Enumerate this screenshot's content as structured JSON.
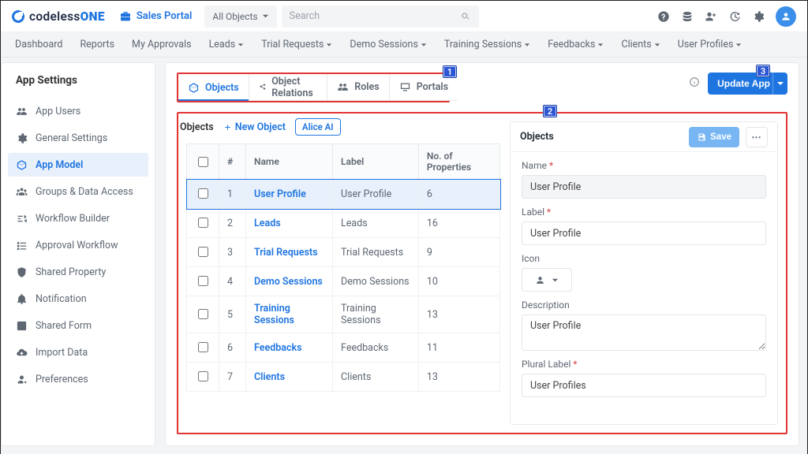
{
  "logo": {
    "text_a": "codeless",
    "text_b": "ONE"
  },
  "portal_name": "Sales Portal",
  "object_selector": "All Objects",
  "search_placeholder": "Search",
  "nav": [
    "Dashboard",
    "Reports",
    "My Approvals",
    "Leads",
    "Trial Requests",
    "Demo Sessions",
    "Training Sessions",
    "Feedbacks",
    "Clients",
    "User Profiles"
  ],
  "nav_caret": [
    false,
    false,
    false,
    true,
    true,
    true,
    true,
    true,
    true,
    true
  ],
  "side_title": "App Settings",
  "side_items": [
    "App Users",
    "General Settings",
    "App Model",
    "Groups & Data Access",
    "Workflow Builder",
    "Approval Workflow",
    "Shared Property",
    "Notification",
    "Shared Form",
    "Import Data",
    "Preferences"
  ],
  "side_active_index": 2,
  "tabs": [
    "Objects",
    "Object Relations",
    "Roles",
    "Portals"
  ],
  "tab_active_index": 0,
  "update_btn": "Update App",
  "crumbs_label": "Objects",
  "new_object": "New Object",
  "alice_ai": "Alice AI",
  "table_headers": [
    "",
    "#",
    "Name",
    "Label",
    "No. of Properties"
  ],
  "table_rows": [
    {
      "n": 1,
      "name": "User Profile",
      "label": "User Profile",
      "props": 6,
      "selected": true
    },
    {
      "n": 2,
      "name": "Leads",
      "label": "Leads",
      "props": 16
    },
    {
      "n": 3,
      "name": "Trial Requests",
      "label": "Trial Requests",
      "props": 9
    },
    {
      "n": 4,
      "name": "Demo Sessions",
      "label": "Demo Sessions",
      "props": 10
    },
    {
      "n": 5,
      "name": "Training Sessions",
      "label": "Training Sessions",
      "props": 13
    },
    {
      "n": 6,
      "name": "Feedbacks",
      "label": "Feedbacks",
      "props": 11
    },
    {
      "n": 7,
      "name": "Clients",
      "label": "Clients",
      "props": 13
    }
  ],
  "form": {
    "title": "Objects",
    "save": "Save",
    "fields": {
      "name_label": "Name",
      "name_value": "User Profile",
      "label_label": "Label",
      "label_value": "User Profile",
      "icon_label": "Icon",
      "desc_label": "Description",
      "desc_value": "User Profile",
      "plural_label": "Plural Label",
      "plural_value": "User Profiles"
    }
  },
  "markers": {
    "m1": "1",
    "m2": "2",
    "m3": "3"
  }
}
